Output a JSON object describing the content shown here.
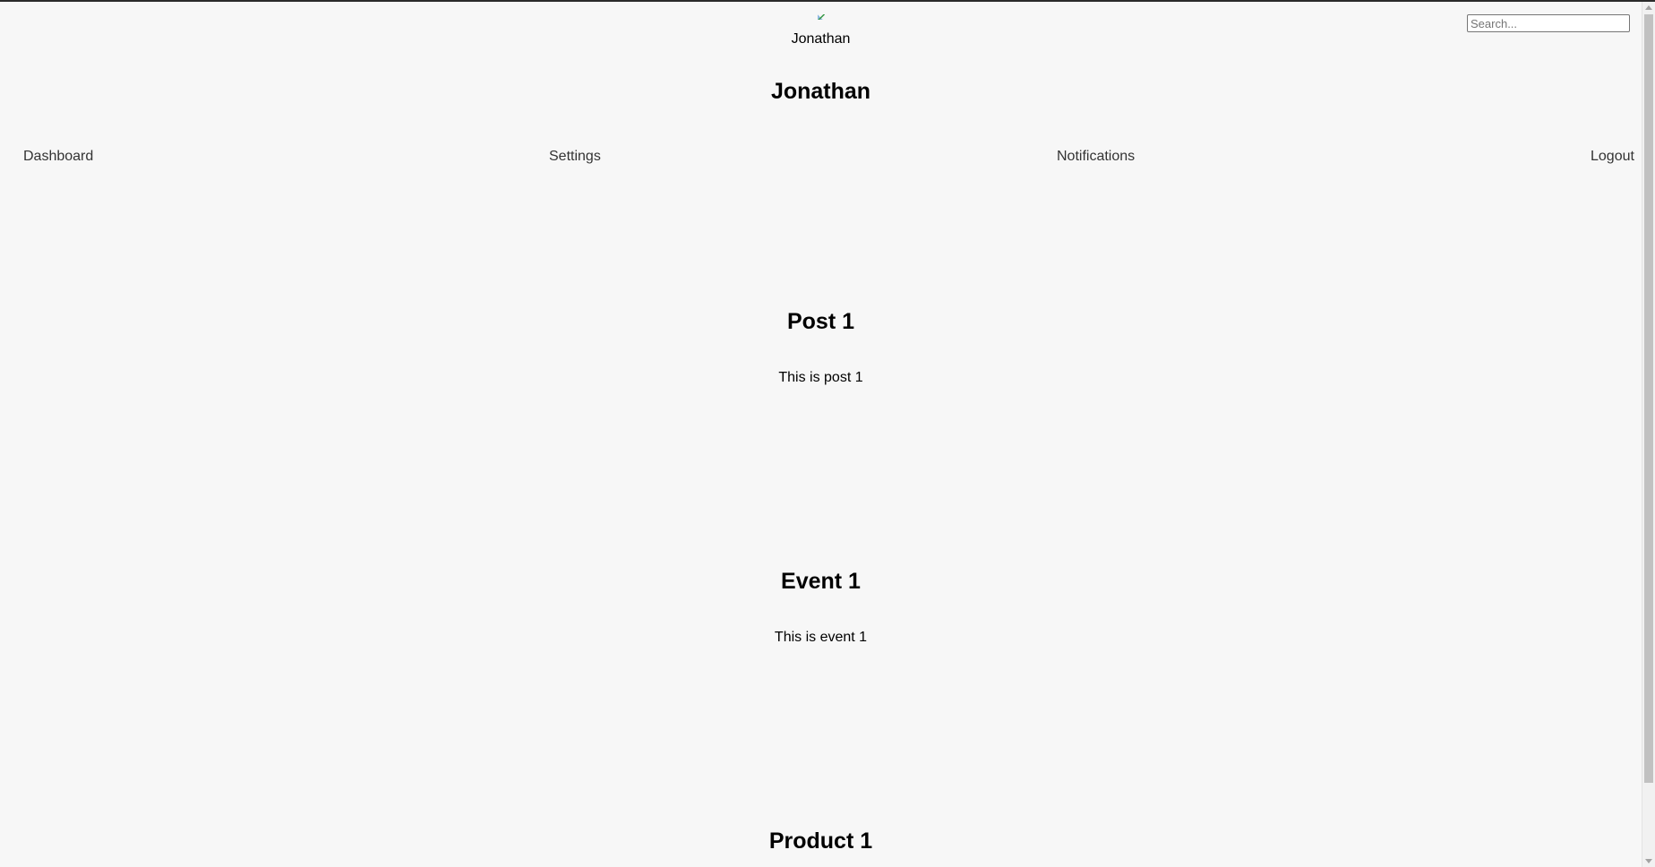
{
  "header": {
    "avatar_alt": "Jonathan",
    "title": "Jonathan",
    "search": {
      "placeholder": "Search...",
      "value": ""
    }
  },
  "nav": {
    "items": [
      {
        "label": "Dashboard"
      },
      {
        "label": "Settings"
      },
      {
        "label": "Notifications"
      },
      {
        "label": "Logout"
      }
    ]
  },
  "feed": [
    {
      "title": "Post 1",
      "text": "This is post 1"
    },
    {
      "title": "Event 1",
      "text": "This is event 1"
    },
    {
      "title": "Product 1",
      "text": ""
    }
  ]
}
